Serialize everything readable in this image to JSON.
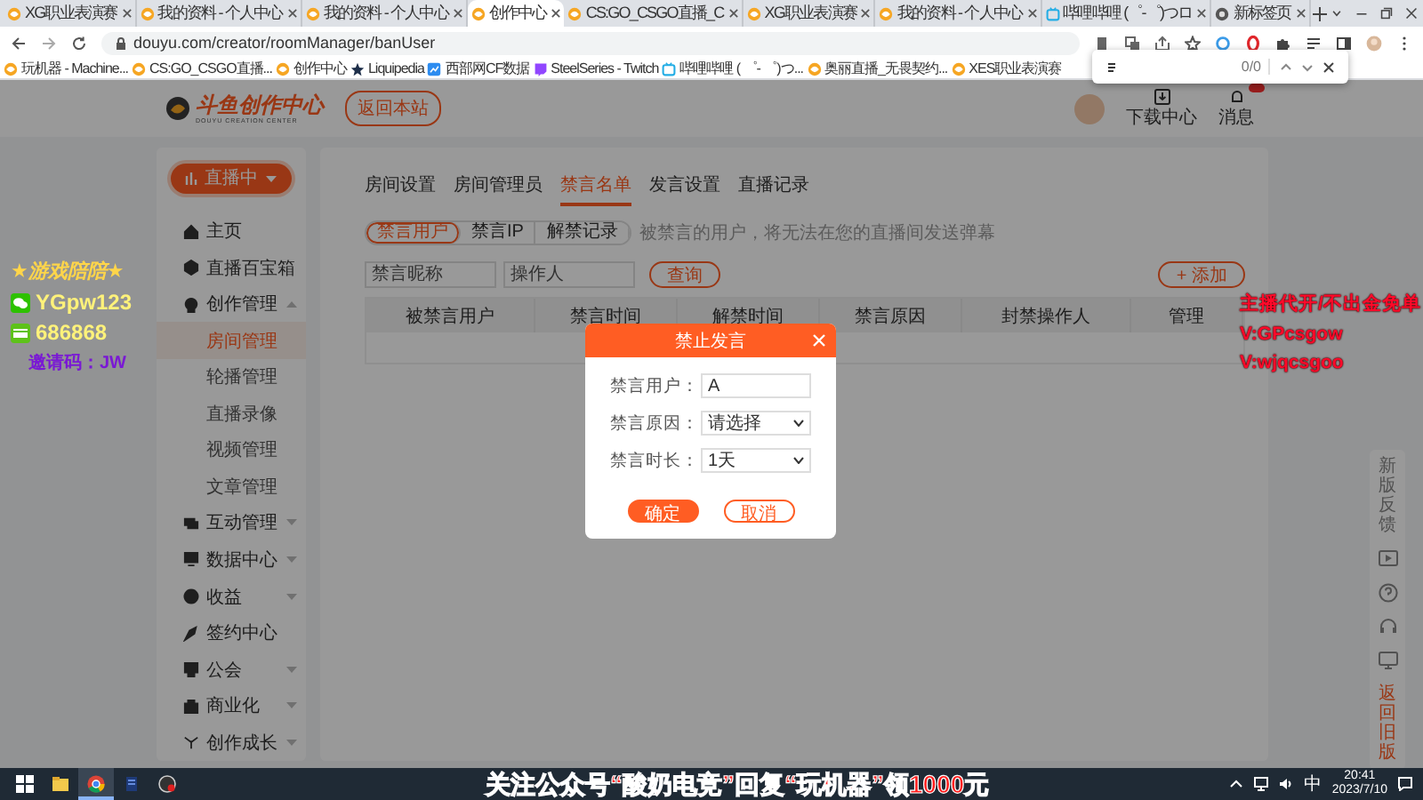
{
  "browser": {
    "tabs": [
      {
        "title": "XG职业表演赛",
        "kind": "fish",
        "selected": false
      },
      {
        "title": "我的资料 - 个人中心",
        "kind": "fish",
        "selected": false
      },
      {
        "title": "我的资料 - 个人中心",
        "kind": "fish",
        "selected": false
      },
      {
        "title": "创作中心",
        "kind": "fish",
        "selected": true
      },
      {
        "title": "CS:GO_CSGO直播_C",
        "kind": "fish",
        "selected": false
      },
      {
        "title": "XG职业表演赛",
        "kind": "fish",
        "selected": false
      },
      {
        "title": "我的资料 - 个人中心",
        "kind": "fish",
        "selected": false
      },
      {
        "title": "哔哩哔哩 (゜-゜)つロ",
        "kind": "tv",
        "selected": false
      },
      {
        "title": "新标签页",
        "kind": "globe",
        "selected": false
      }
    ],
    "address": "douyu.com/creator/roomManager/banUser",
    "bookmarks": [
      {
        "title": "玩机器 - Machine...",
        "kind": "fish"
      },
      {
        "title": "CS:GO_CSGO直播...",
        "kind": "fish"
      },
      {
        "title": "创作中心",
        "kind": "fish"
      },
      {
        "title": "Liquipedia",
        "kind": "star"
      },
      {
        "title": "西部网CF数据",
        "kind": "square"
      },
      {
        "title": "SteelSeries - Twitch",
        "kind": "twitch"
      },
      {
        "title": "哔哩哔哩 ( ゜- ゜)つ...",
        "kind": "tv"
      },
      {
        "title": "奥丽直播_无畏契约...",
        "kind": "fish"
      },
      {
        "title": "XES职业表演赛",
        "kind": "fish"
      }
    ],
    "find_bar": {
      "count": "0/0"
    }
  },
  "header": {
    "logo_title": "斗鱼创作中心",
    "logo_subtitle": "DOUYU CREATION CENTER",
    "back_button": "返回本站",
    "download": "下载中心",
    "messages": "消息"
  },
  "sidebar": {
    "live_button": "直播中",
    "items": [
      {
        "label": "主页"
      },
      {
        "label": "直播百宝箱"
      },
      {
        "label": "创作管理",
        "expanded": true,
        "children": [
          {
            "label": "房间管理",
            "selected": true
          },
          {
            "label": "轮播管理",
            "selected": false
          },
          {
            "label": "直播录像",
            "selected": false
          },
          {
            "label": "视频管理",
            "selected": false
          },
          {
            "label": "文章管理",
            "selected": false
          }
        ]
      },
      {
        "label": "互动管理",
        "expanded": false
      },
      {
        "label": "数据中心",
        "expanded": false
      },
      {
        "label": "收益",
        "expanded": false
      },
      {
        "label": "签约中心"
      },
      {
        "label": "公会",
        "expanded": false
      },
      {
        "label": "商业化",
        "expanded": false
      },
      {
        "label": "创作成长",
        "expanded": false
      }
    ]
  },
  "content": {
    "tabs": [
      {
        "label": "房间设置",
        "selected": false
      },
      {
        "label": "房间管理员",
        "selected": false
      },
      {
        "label": "禁言名单",
        "selected": true
      },
      {
        "label": "发言设置",
        "selected": false
      },
      {
        "label": "直播记录",
        "selected": false
      }
    ],
    "sub_tabs": [
      {
        "label": "禁言用户",
        "selected": true
      },
      {
        "label": "禁言IP",
        "selected": false
      },
      {
        "label": "解禁记录",
        "selected": false
      }
    ],
    "hint": "被禁言的用户，将无法在您的直播间发送弹幕",
    "filters": [
      {
        "placeholder": "禁言昵称"
      },
      {
        "placeholder": "操作人"
      }
    ],
    "search_button": "查询",
    "add_button": "+ 添加",
    "table": {
      "columns": [
        "被禁言用户",
        "禁言时间",
        "解禁时间",
        "禁言原因",
        "封禁操作人",
        "管理"
      ]
    }
  },
  "dialog": {
    "title": "禁止发言",
    "fields": [
      {
        "kind": "input",
        "label": "禁言用户：",
        "value": "A"
      },
      {
        "kind": "select",
        "label": "禁言原因：",
        "value": "请选择"
      },
      {
        "kind": "select",
        "label": "禁言时长：",
        "value": "1天"
      }
    ],
    "buttons": [
      {
        "label": "确定",
        "kind": "primary"
      },
      {
        "label": "取消",
        "kind": "secondary"
      }
    ]
  },
  "float_panel": {
    "top": "新版反馈",
    "bottom": "返回旧版"
  },
  "overlays": {
    "left": [
      {
        "kind": "title",
        "text": "★游戏陪陪★"
      },
      {
        "kind": "wechat",
        "text": "YGpw123"
      },
      {
        "kind": "card",
        "text": "686868"
      },
      {
        "kind": "code",
        "text": "邀请码：JW"
      }
    ],
    "right": [
      "主播代开/不出金免单",
      "V:GPcsgow",
      "V:wjqcsgoo"
    ],
    "banner": "关注公众号“酸奶电竞”回复“玩机器”领1000元"
  },
  "taskbar": {
    "apps": [
      {
        "kind": "folder",
        "selected": false
      },
      {
        "kind": "browser",
        "selected": true
      },
      {
        "kind": "doc",
        "selected": false
      },
      {
        "kind": "recorder",
        "selected": false
      }
    ],
    "ime": "中",
    "time": "20:41",
    "date": "2023/7/10"
  }
}
